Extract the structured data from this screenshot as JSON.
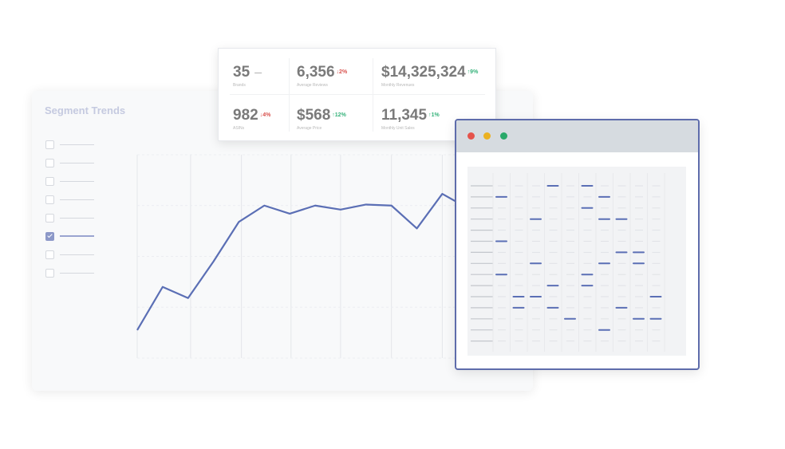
{
  "trend_card": {
    "title": "Segment Trends",
    "segments": [
      {
        "checked": false
      },
      {
        "checked": false
      },
      {
        "checked": false
      },
      {
        "checked": false
      },
      {
        "checked": false
      },
      {
        "checked": true
      },
      {
        "checked": false
      },
      {
        "checked": false
      }
    ],
    "accent_color": "#5b6fb5"
  },
  "chart_data": {
    "type": "line",
    "x": [
      0,
      1,
      2,
      3,
      4,
      5,
      6,
      7,
      8,
      9,
      10,
      11,
      12,
      13,
      14,
      15
    ],
    "series": [
      {
        "values": [
          55,
          140,
          118,
          190,
          268,
          300,
          284,
          300,
          292,
          302,
          300,
          255,
          323,
          295,
          245,
          245
        ]
      }
    ],
    "xlim": [
      0,
      15
    ],
    "ylim": [
      0,
      400
    ],
    "grid": true
  },
  "kpis": [
    {
      "value": "35",
      "change": "—",
      "trend": "neutral",
      "label": "Brands"
    },
    {
      "value": "6,356",
      "change": "↓2%",
      "trend": "down",
      "label": "Average Reviews"
    },
    {
      "value": "$14,325,324",
      "change": "↑9%",
      "trend": "up",
      "label": "Monthly Revenues"
    },
    {
      "value": "982",
      "change": "↓4%",
      "trend": "down",
      "label": "ASINs"
    },
    {
      "value": "$568",
      "change": "↑12%",
      "trend": "up",
      "label": "Average Price"
    },
    {
      "value": "11,345",
      "change": "↑1%",
      "trend": "up",
      "label": "Monthly Unit Sales"
    }
  ],
  "browser": {
    "dots": [
      "#e5534b",
      "#ebb121",
      "#29a96a"
    ],
    "grid": {
      "rows": 15,
      "cols": 11,
      "marks": [
        [
          0,
          4
        ],
        [
          0,
          6
        ],
        [
          1,
          1
        ],
        [
          1,
          7
        ],
        [
          2,
          6
        ],
        [
          3,
          3
        ],
        [
          3,
          7
        ],
        [
          3,
          8
        ],
        [
          5,
          1
        ],
        [
          6,
          8
        ],
        [
          6,
          9
        ],
        [
          7,
          3
        ],
        [
          7,
          7
        ],
        [
          7,
          9
        ],
        [
          8,
          1
        ],
        [
          8,
          6
        ],
        [
          9,
          4
        ],
        [
          9,
          6
        ],
        [
          10,
          2
        ],
        [
          10,
          3
        ],
        [
          10,
          10
        ],
        [
          11,
          2
        ],
        [
          11,
          4
        ],
        [
          11,
          8
        ],
        [
          12,
          5
        ],
        [
          12,
          9
        ],
        [
          12,
          10
        ],
        [
          13,
          7
        ]
      ]
    }
  }
}
